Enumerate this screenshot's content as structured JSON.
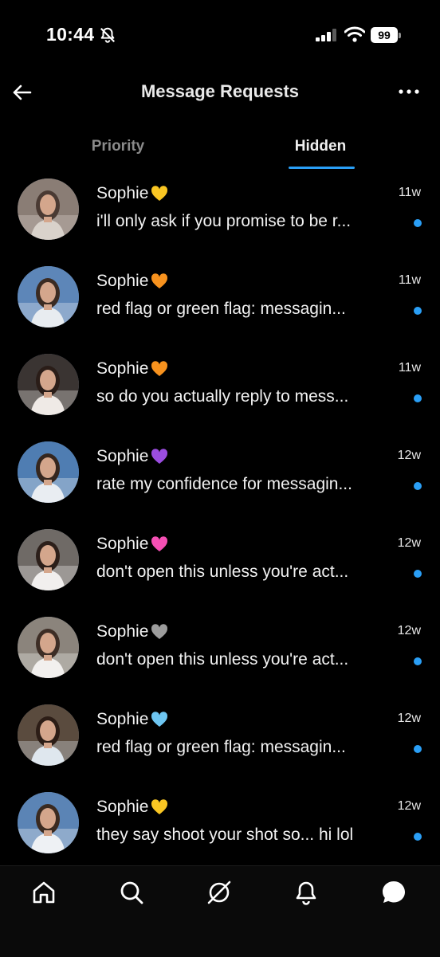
{
  "status_bar": {
    "time": "10:44",
    "battery": "99"
  },
  "header": {
    "title": "Message Requests"
  },
  "tabs": [
    {
      "label": "Priority",
      "active": false
    },
    {
      "label": "Hidden",
      "active": true
    }
  ],
  "colors": {
    "accent": "#2a9ff6",
    "background": "#000000"
  },
  "requests": [
    {
      "name": "Sophie",
      "emoji": "yellow-heart",
      "time": "11w",
      "preview": "i'll only ask if you promise to be r...",
      "unread": true
    },
    {
      "name": "Sophie",
      "emoji": "orange-heart",
      "time": "11w",
      "preview": "red flag or green flag: messagin...",
      "unread": true
    },
    {
      "name": "Sophie",
      "emoji": "orange-heart",
      "time": "11w",
      "preview": "so do you actually reply to mess...",
      "unread": true
    },
    {
      "name": "Sophie",
      "emoji": "purple-heart",
      "time": "12w",
      "preview": "rate my confidence for messagin...",
      "unread": true
    },
    {
      "name": "Sophie",
      "emoji": "pink-heart",
      "time": "12w",
      "preview": "don't open this unless you're act...",
      "unread": true
    },
    {
      "name": "Sophie",
      "emoji": "grey-heart",
      "time": "12w",
      "preview": "don't open this unless you're act...",
      "unread": true
    },
    {
      "name": "Sophie",
      "emoji": "light-blue-heart",
      "time": "12w",
      "preview": "red flag or green flag: messagin...",
      "unread": true
    },
    {
      "name": "Sophie",
      "emoji": "yellow-heart",
      "time": "12w",
      "preview": "they say shoot your shot so... hi lol",
      "unread": true
    }
  ],
  "bottom_nav": [
    "home-icon",
    "search-icon",
    "explore-icon",
    "notifications-icon",
    "messages-icon"
  ]
}
